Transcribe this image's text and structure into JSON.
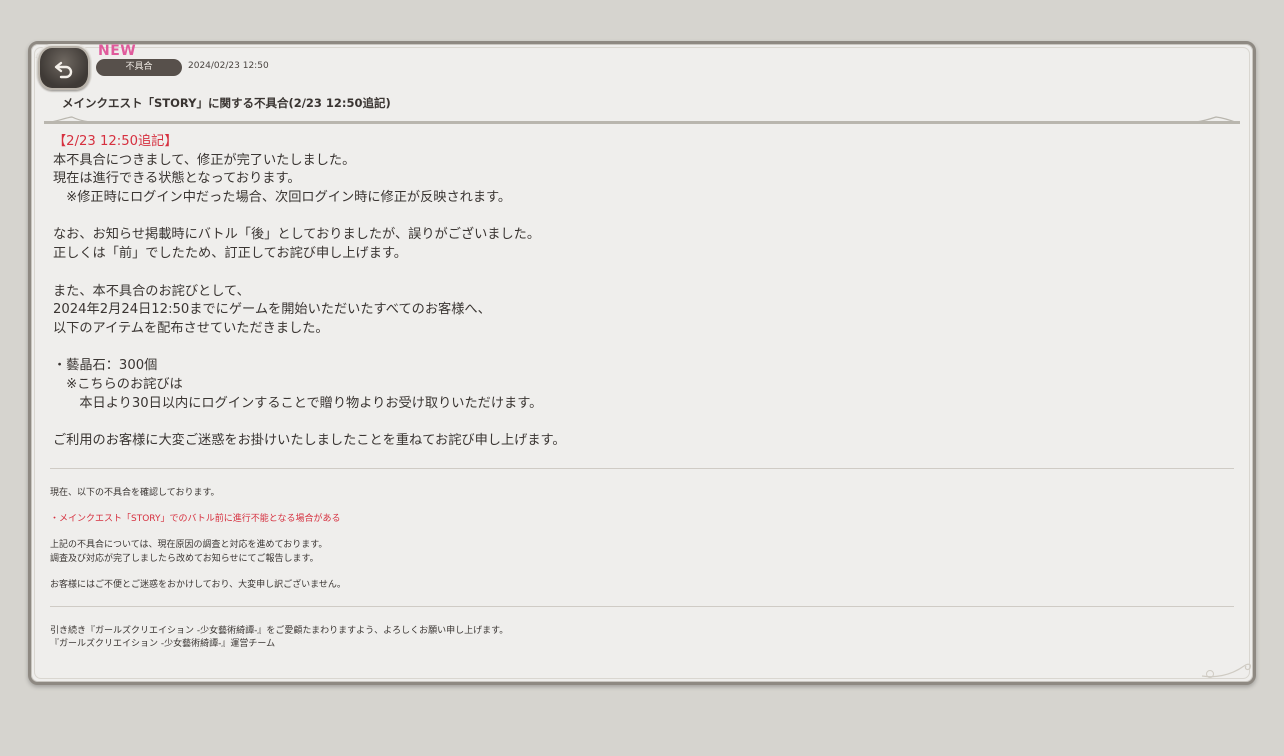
{
  "header": {
    "new_badge": "NEW",
    "category": "不具合",
    "date": "2024/02/23 12:50",
    "title": "メインクエスト「STORY」に関する不具合(2/23 12:50追記)"
  },
  "body": {
    "lines": [
      "【2/23 12:50追記】",
      "本不具合につきまして、修正が完了いたしました。",
      "現在は進行できる状態となっております。",
      "　※修正時にログイン中だった場合、次回ログイン時に修正が反映されます。",
      "",
      "なお、お知らせ掲載時にバトル「後」としておりましたが、誤りがございました。",
      "正しくは「前」でしたため、訂正してお詫び申し上げます。",
      "",
      "また、本不具合のお詫びとして、",
      "2024年2月24日12:50までにゲームを開始いただいたすべてのお客様へ、",
      "以下のアイテムを配布させていただきました。",
      "",
      "・藝晶石：300個",
      "　※こちらのお詫びは",
      "　　本日より30日以内にログインすることで贈り物よりお受け取りいただけます。",
      "",
      "ご利用のお客様に大変ご迷惑をお掛けいたしましたことを重ねてお詫び申し上げます。"
    ]
  },
  "details": {
    "confirming": "現在、以下の不具合を確認しております。",
    "issue": "・メインクエスト「STORY」でのバトル前に進行不能となる場合がある",
    "investigating_1": "上記の不具合については、現在原因の調査と対応を進めております。",
    "investigating_2": "調査及び対応が完了しましたら改めてお知らせにてご報告します。",
    "apology": "お客様にはご不便とご迷惑をおかけしており、大変申し訳ございません。"
  },
  "footer": {
    "line_1": "引き続き『ガールズクリエイション -少女藝術綺譚-』をご愛顧たまわりますよう、よろしくお願い申し上げます。",
    "line_2": "『ガールズクリエイション -少女藝術綺譚-』運営チーム"
  },
  "colors": {
    "accent_red": "#d6303f",
    "new_pink": "#e05b9c",
    "pill_bg": "#57504b",
    "panel_bg": "#efeeec",
    "page_bg": "#d6d4cf"
  },
  "icons": {
    "back": "back-arrow-icon"
  }
}
